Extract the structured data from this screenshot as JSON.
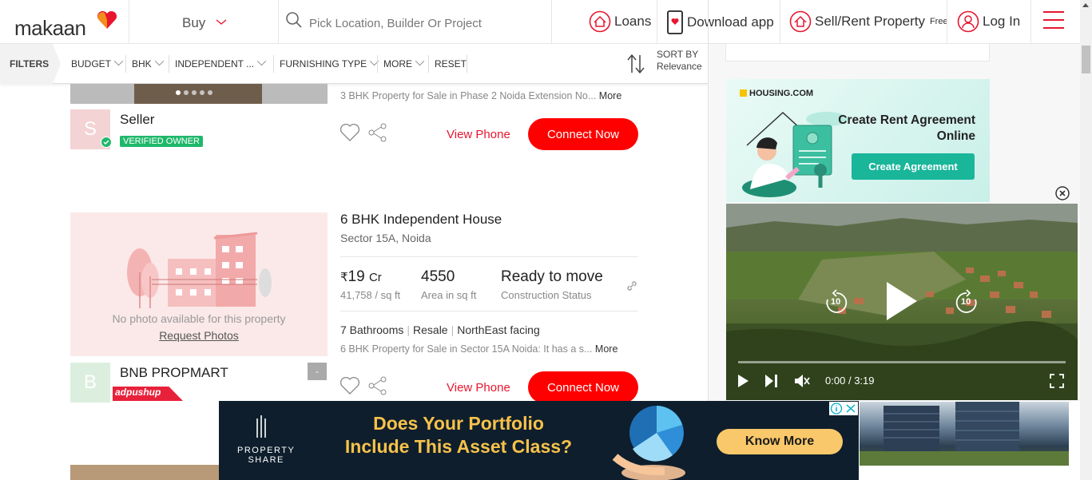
{
  "header": {
    "logo_text": "makaan",
    "buy_label": "Buy",
    "search_placeholder": "Pick Location, Builder Or Project",
    "loans_label": "Loans",
    "download_label": "Download app",
    "sell_label": "Sell/Rent Property",
    "sell_sup": "Free",
    "login_label": "Log In"
  },
  "filters": {
    "filters_label": "FILTERS",
    "items": [
      "BUDGET",
      "BHK",
      "INDEPENDENT ...",
      "FURNISHING TYPE",
      "MORE"
    ],
    "reset_label": "RESET",
    "sort_label": "SORT BY",
    "sort_value": "Relevance"
  },
  "listing1": {
    "desc": "3 BHK Property for Sale in Phase 2 Noida Extension No...",
    "more": "More",
    "avatar_letter": "S",
    "seller_name": "Seller",
    "badge": "VERIFIED OWNER",
    "view_phone": "View Phone",
    "connect": "Connect Now"
  },
  "listing2": {
    "no_photo": "No photo available for this property",
    "request_photos": "Request Photos",
    "title": "6 BHK Independent House",
    "location": "Sector 15A, Noida",
    "price_symbol": "₹",
    "price": "19",
    "price_unit": "Cr",
    "price_per_sqft": "41,758 / sq ft",
    "area": "4550",
    "area_label": "Area in sq ft",
    "status": "Ready to move",
    "status_label": "Construction Status",
    "tags": [
      "7 Bathrooms",
      "Resale",
      "NorthEast facing"
    ],
    "desc": "6 BHK Property for Sale in Sector 15A Noida: It has a s...",
    "more": "More",
    "avatar_letter": "B",
    "seller_name": "BNB PROPMART",
    "grey_box": "-",
    "adpushup": "adpushup",
    "view_phone": "View Phone",
    "connect": "Connect Now"
  },
  "housing_ad": {
    "logo": "HOUSING.COM",
    "title": "Create Rent Agreement Online",
    "button": "Create Agreement"
  },
  "video": {
    "time_current": "0:00",
    "time_sep": "/",
    "time_total": "3:19",
    "rewind": "10",
    "forward": "10"
  },
  "bottom_ad": {
    "brand_line1": "PROPERTY",
    "brand_line2": "SHARE",
    "headline_line1": "Does Your  Portfolio",
    "headline_line2": "Include This Asset Class?",
    "button": "Know More"
  },
  "colors": {
    "brand_red": "#e7162e",
    "connect_red": "#ff0000",
    "verified_green": "#1fb86b",
    "housing_teal": "#19b69a"
  }
}
